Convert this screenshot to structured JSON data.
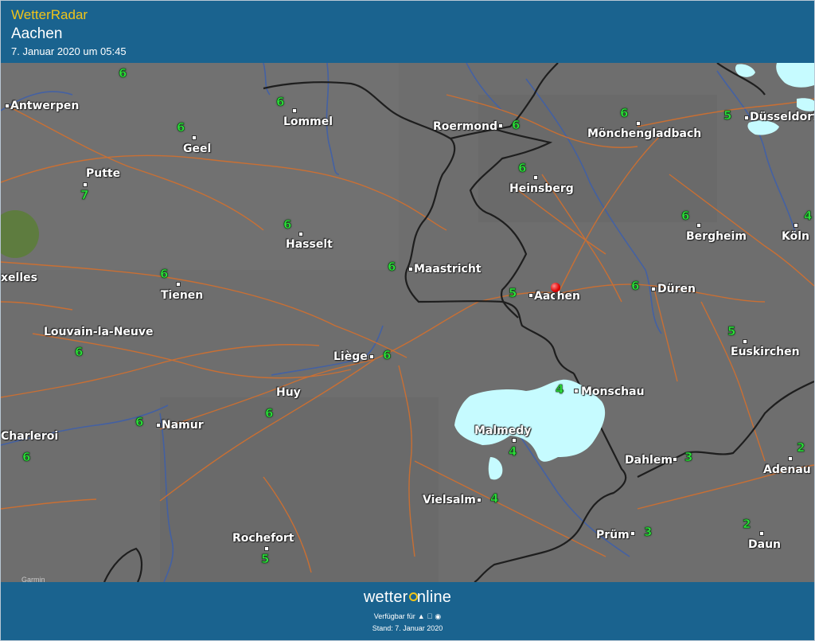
{
  "header": {
    "app_title": "WetterRadar",
    "location": "Aachen",
    "timestamp": "7. Januar 2020 um 05:45"
  },
  "map": {
    "cities": [
      {
        "id": "antwerpen",
        "name": "Antwerpen"
      },
      {
        "id": "lommel",
        "name": "Lommel"
      },
      {
        "id": "roermond",
        "name": "Roermond"
      },
      {
        "id": "moenchengladbach",
        "name": "Mönchengladbach"
      },
      {
        "id": "duesseldorf",
        "name": "Düsseldorf"
      },
      {
        "id": "geel",
        "name": "Geel"
      },
      {
        "id": "putte",
        "name": "Putte"
      },
      {
        "id": "heinsberg",
        "name": "Heinsberg"
      },
      {
        "id": "hasselt",
        "name": "Hasselt"
      },
      {
        "id": "bergheim",
        "name": "Bergheim"
      },
      {
        "id": "koeln",
        "name": "Köln"
      },
      {
        "id": "bruxelles",
        "name": "xelles"
      },
      {
        "id": "maastricht",
        "name": "Maastricht"
      },
      {
        "id": "tienen",
        "name": "Tienen"
      },
      {
        "id": "aachen",
        "name": "Aachen"
      },
      {
        "id": "dueren",
        "name": "Düren"
      },
      {
        "id": "louvain",
        "name": "Louvain-la-Neuve"
      },
      {
        "id": "liege",
        "name": "Liège"
      },
      {
        "id": "euskirchen",
        "name": "Euskirchen"
      },
      {
        "id": "huy",
        "name": "Huy"
      },
      {
        "id": "monschau",
        "name": "Monschau"
      },
      {
        "id": "namur",
        "name": "Namur"
      },
      {
        "id": "charleroi",
        "name": "Charleroi"
      },
      {
        "id": "malmedy",
        "name": "Malmedy"
      },
      {
        "id": "dahlem",
        "name": "Dahlem"
      },
      {
        "id": "adenau",
        "name": "Adenau"
      },
      {
        "id": "vielsalm",
        "name": "Vielsalm"
      },
      {
        "id": "pruem",
        "name": "Prüm"
      },
      {
        "id": "rochefort",
        "name": "Rochefort"
      },
      {
        "id": "daun",
        "name": "Daun"
      }
    ],
    "temperatures": [
      {
        "id": "t1",
        "value": "6"
      },
      {
        "id": "t2",
        "value": "6"
      },
      {
        "id": "t3",
        "value": "6"
      },
      {
        "id": "t4",
        "value": "6"
      },
      {
        "id": "t5",
        "value": "5"
      },
      {
        "id": "t6",
        "value": "6"
      },
      {
        "id": "t7",
        "value": "7"
      },
      {
        "id": "t8",
        "value": "6"
      },
      {
        "id": "t9",
        "value": "6"
      },
      {
        "id": "t10",
        "value": "6"
      },
      {
        "id": "t11",
        "value": "4"
      },
      {
        "id": "t12",
        "value": "6"
      },
      {
        "id": "t13",
        "value": "6"
      },
      {
        "id": "t14",
        "value": "5"
      },
      {
        "id": "t15",
        "value": "6"
      },
      {
        "id": "t16",
        "value": "6"
      },
      {
        "id": "t17",
        "value": "6"
      },
      {
        "id": "t18",
        "value": "5"
      },
      {
        "id": "t19",
        "value": "6"
      },
      {
        "id": "t20",
        "value": "4"
      },
      {
        "id": "t21",
        "value": "6"
      },
      {
        "id": "t22",
        "value": "6"
      },
      {
        "id": "t23",
        "value": "4"
      },
      {
        "id": "t24",
        "value": "3"
      },
      {
        "id": "t25",
        "value": "2"
      },
      {
        "id": "t26",
        "value": "4"
      },
      {
        "id": "t27",
        "value": "3"
      },
      {
        "id": "t28",
        "value": "2"
      },
      {
        "id": "t29",
        "value": "5"
      }
    ],
    "copyright": "Garmin",
    "colors": {
      "roads": "#d9702a",
      "borders": "#1e1e1e",
      "rivers": "#3f5fa8",
      "snow": "#c6fbff",
      "land": "#6f6f6f",
      "green_cell": "#5c7d3a"
    }
  },
  "footer": {
    "brand_pre": "wetter",
    "brand_o": "o",
    "brand_post": "nline",
    "available": "Verfügbar für",
    "stand": "Stand: 7. Januar 2020"
  }
}
